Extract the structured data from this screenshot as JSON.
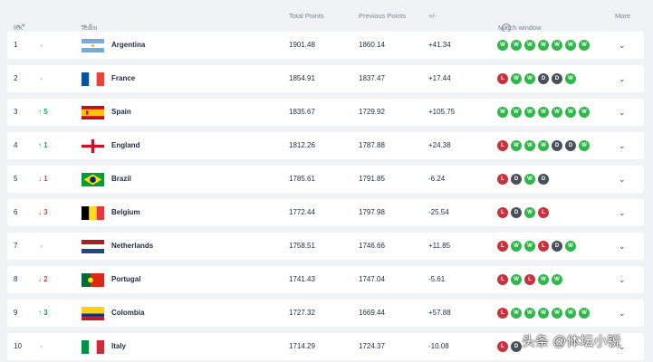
{
  "header": {
    "rk": "RK",
    "team": "Team",
    "total_points": "Total Points",
    "previous_points": "Previous Points",
    "diff": "+/-",
    "match_window": "Match window",
    "more": "More"
  },
  "rows": [
    {
      "rk": "1",
      "move_dir": "same",
      "move_val": "",
      "team": "Argentina",
      "flag": "argentina",
      "total": "1901.48",
      "prev": "1860.14",
      "diff": "+41.34",
      "results": [
        "W",
        "W",
        "W",
        "W",
        "W",
        "W",
        "W"
      ]
    },
    {
      "rk": "2",
      "move_dir": "same",
      "move_val": "",
      "team": "France",
      "flag": "france",
      "total": "1854.91",
      "prev": "1837.47",
      "diff": "+17.44",
      "results": [
        "L",
        "W",
        "W",
        "D",
        "D",
        "W"
      ]
    },
    {
      "rk": "3",
      "move_dir": "up",
      "move_val": "5",
      "team": "Spain",
      "flag": "spain",
      "total": "1835.67",
      "prev": "1729.92",
      "diff": "+105.75",
      "results": [
        "W",
        "W",
        "W",
        "W",
        "W",
        "W",
        "W"
      ]
    },
    {
      "rk": "4",
      "move_dir": "up",
      "move_val": "1",
      "team": "England",
      "flag": "england",
      "total": "1812.26",
      "prev": "1787.88",
      "diff": "+24.38",
      "results": [
        "L",
        "W",
        "W",
        "W",
        "D",
        "D",
        "W"
      ]
    },
    {
      "rk": "5",
      "move_dir": "down",
      "move_val": "1",
      "team": "Brazil",
      "flag": "brazil",
      "total": "1785.61",
      "prev": "1791.85",
      "diff": "-6.24",
      "results": [
        "L",
        "D",
        "W",
        "D"
      ]
    },
    {
      "rk": "6",
      "move_dir": "down",
      "move_val": "3",
      "team": "Belgium",
      "flag": "belgium",
      "total": "1772.44",
      "prev": "1797.98",
      "diff": "-25.54",
      "results": [
        "L",
        "D",
        "W",
        "L"
      ]
    },
    {
      "rk": "7",
      "move_dir": "same",
      "move_val": "",
      "team": "Netherlands",
      "flag": "netherlands",
      "total": "1758.51",
      "prev": "1746.66",
      "diff": "+11.85",
      "results": [
        "L",
        "W",
        "W",
        "L",
        "D",
        "W"
      ]
    },
    {
      "rk": "8",
      "move_dir": "down",
      "move_val": "2",
      "team": "Portugal",
      "flag": "portugal",
      "total": "1741.43",
      "prev": "1747.04",
      "diff": "-5.61",
      "results": [
        "L",
        "W",
        "L",
        "W",
        "W"
      ]
    },
    {
      "rk": "9",
      "move_dir": "up",
      "move_val": "3",
      "team": "Colombia",
      "flag": "colombia",
      "total": "1727.32",
      "prev": "1669.44",
      "diff": "+57.88",
      "results": [
        "L",
        "W",
        "W",
        "W",
        "W",
        "W",
        "W"
      ]
    },
    {
      "rk": "10",
      "move_dir": "same",
      "move_val": "",
      "team": "Italy",
      "flag": "italy",
      "total": "1714.29",
      "prev": "1724.37",
      "diff": "-10.08",
      "results": [
        "L",
        "D"
      ]
    }
  ],
  "watermark": "头条 @体坛小锐",
  "colors": {
    "win": "#2fb84a",
    "loss": "#c8323c",
    "draw": "#4a4f5a",
    "up": "#1aa35c",
    "down": "#d64545"
  }
}
